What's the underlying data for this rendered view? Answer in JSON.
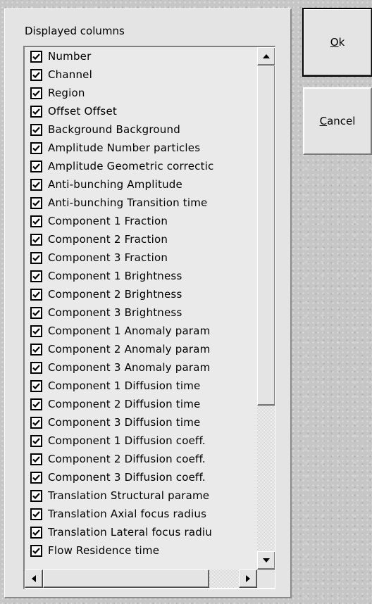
{
  "dialog": {
    "group_label": "Displayed columns",
    "ok_label": {
      "accel": "O",
      "rest": "k"
    },
    "cancel_label": {
      "accel": "C",
      "rest": "ancel"
    }
  },
  "columns": [
    {
      "label": "Number",
      "checked": true
    },
    {
      "label": "Channel",
      "checked": true
    },
    {
      "label": "Region",
      "checked": true
    },
    {
      "label": "Offset Offset",
      "checked": true
    },
    {
      "label": "Background Background",
      "checked": true
    },
    {
      "label": "Amplitude Number particles",
      "checked": true
    },
    {
      "label": "Amplitude Geometric correctic",
      "checked": true
    },
    {
      "label": "Anti-bunching Amplitude",
      "checked": true
    },
    {
      "label": "Anti-bunching Transition time",
      "checked": true
    },
    {
      "label": "Component 1 Fraction",
      "checked": true
    },
    {
      "label": "Component 2 Fraction",
      "checked": true
    },
    {
      "label": "Component 3 Fraction",
      "checked": true
    },
    {
      "label": "Component 1 Brightness",
      "checked": true
    },
    {
      "label": "Component 2 Brightness",
      "checked": true
    },
    {
      "label": "Component 3 Brightness",
      "checked": true
    },
    {
      "label": "Component 1 Anomaly param",
      "checked": true
    },
    {
      "label": "Component 2 Anomaly param",
      "checked": true
    },
    {
      "label": "Component 3 Anomaly param",
      "checked": true
    },
    {
      "label": "Component 1 Diffusion time",
      "checked": true
    },
    {
      "label": "Component 2 Diffusion time",
      "checked": true
    },
    {
      "label": "Component 3 Diffusion time",
      "checked": true
    },
    {
      "label": "Component 1 Diffusion coeff.",
      "checked": true
    },
    {
      "label": "Component 2 Diffusion coeff.",
      "checked": true
    },
    {
      "label": "Component 3 Diffusion coeff.",
      "checked": true
    },
    {
      "label": "Translation Structural parame",
      "checked": true
    },
    {
      "label": "Translation Axial focus radius",
      "checked": true
    },
    {
      "label": "Translation Lateral focus radiu",
      "checked": true
    },
    {
      "label": "Flow Residence time",
      "checked": true
    }
  ],
  "scrollbar": {
    "vertical_position": 0.0,
    "vertical_visible_fraction": 0.7,
    "horizontal_position": 0.0,
    "horizontal_visible_fraction": 0.85
  },
  "icons": {
    "checkbox": "checkmark-icon",
    "scroll_up": "triangle-up-icon",
    "scroll_down": "triangle-down-icon",
    "scroll_left": "triangle-left-icon",
    "scroll_right": "triangle-right-icon"
  }
}
